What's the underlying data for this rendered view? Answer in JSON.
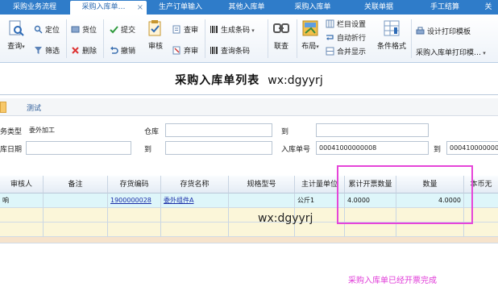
{
  "tabs": [
    {
      "label": "采购业务流程",
      "active": false
    },
    {
      "label": "采购入库单…",
      "active": true
    },
    {
      "label": "生产订单输入",
      "active": false
    },
    {
      "label": "其他入库单",
      "active": false
    },
    {
      "label": "采购入库单",
      "active": false
    },
    {
      "label": "关联单据",
      "active": false
    },
    {
      "label": "手工结算",
      "active": false
    },
    {
      "label": "关",
      "active": false
    }
  ],
  "tab_close": "×",
  "toolbar": {
    "query": "查询",
    "locate": "定位",
    "filter": "筛选",
    "cargo_pos": "货位",
    "delete": "删除",
    "submit": "提交",
    "withdraw": "撤销",
    "audit": "审核",
    "view_audit": "查审",
    "abandon_audit": "弃审",
    "generate_barcode": "生成条码",
    "query_barcode": "查询条码",
    "joint_query": "联查",
    "layout": "布局",
    "column_settings": "栏目设置",
    "auto_wrap": "自动折行",
    "merge_display": "合并显示",
    "condition_format": "条件格式",
    "design_print_template": "设计打印模板",
    "print_template": "采购入库单打印模…"
  },
  "page": {
    "title": "采购入库单列表",
    "watermark": "wx:dgyyrj"
  },
  "subtab": {
    "label": "测试"
  },
  "filters": {
    "business_type_label": "务类型",
    "business_type_value": "委外加工",
    "warehouse_label": "仓库",
    "to_label_1": "到",
    "date_label": "库日期",
    "to_label_2": "到",
    "receipt_no_label": "入库单号",
    "receipt_no_from": "00041000000008",
    "to_label_3": "到",
    "receipt_no_to": "0004100000000"
  },
  "grid": {
    "columns": [
      "审核人",
      "备注",
      "存货编码",
      "存货名称",
      "规格型号",
      "主计量单位",
      "累计开票数量",
      "数量",
      "本币无"
    ],
    "rows": [
      {
        "auditor": "响",
        "note": "",
        "inventory_code": "1900000028",
        "inventory_name": "委外组件A",
        "spec": "",
        "unit": "公斤1",
        "invoiced_qty": "4.0000",
        "qty": "4.0000",
        "amount": ""
      }
    ],
    "watermark": "wx:dgyyrj"
  },
  "annotation": "采购入库单已经开票完成",
  "colors": {
    "tab_bar": "#2f7cc9",
    "row_selected": "#def6fa",
    "row_alt": "#fbf6d9",
    "highlight": "#e645d9",
    "link": "#1a2ea8"
  }
}
